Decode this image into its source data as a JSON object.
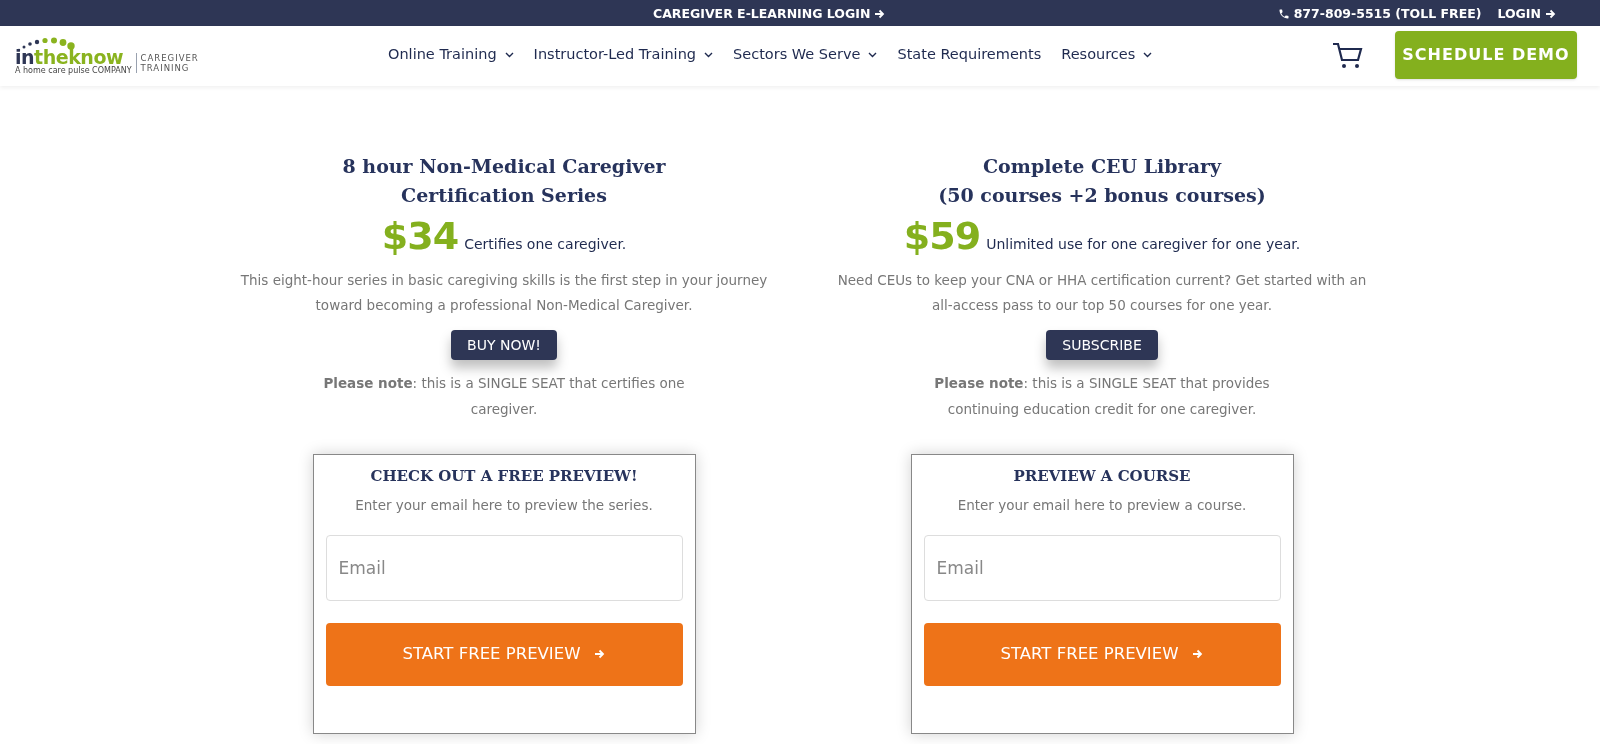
{
  "top_bar": {
    "elearning_link": "CAREGIVER E-LEARNING LOGIN",
    "phone": "877-809-5515 (TOLL FREE)",
    "login_link": "LOGIN"
  },
  "header": {
    "logo": {
      "parts": [
        "in",
        "theknow"
      ],
      "tagline": "A home care pulse COMPANY",
      "side_text": [
        "CAREGIVER",
        "TRAINING"
      ]
    },
    "nav": [
      {
        "label": "Online Training",
        "dropdown": true
      },
      {
        "label": "Instructor-Led Training",
        "dropdown": true
      },
      {
        "label": "Sectors We Serve",
        "dropdown": true
      },
      {
        "label": "State Requirements",
        "dropdown": false
      },
      {
        "label": "Resources",
        "dropdown": true
      }
    ],
    "cta": "SCHEDULE DEMO"
  },
  "offers": [
    {
      "title": [
        "8 hour Non-Medical Caregiver",
        "Certification Series"
      ],
      "price": "$34",
      "price_note": "Certifies one caregiver.",
      "description": "This eight-hour series in basic caregiving skills is the first step in your journey toward becoming a professional Non-Medical Caregiver.",
      "button": "BUY NOW!",
      "note": "**Please note**: this is a SINGLE SEAT that certifies one caregiver.",
      "preview": {
        "title": "CHECK OUT A FREE PREVIEW!",
        "text": "Enter your email here to preview the series.",
        "placeholder": "Email",
        "button": "START FREE PREVIEW"
      }
    },
    {
      "title": [
        "Complete CEU Library",
        "(50 courses +2 bonus courses)"
      ],
      "price": "$59",
      "price_note": "Unlimited use for one caregiver for one year.",
      "description": "Need CEUs to keep your CNA or HHA certification current? Get started with an all-access pass to our top 50 courses for one year.",
      "button": "SUBSCRIBE",
      "note": "**Please note**: this is a SINGLE SEAT that provides continuing education credit for one caregiver.",
      "preview": {
        "title": "PREVIEW A COURSE",
        "text": "Enter your email here to preview a course.",
        "placeholder": "Email",
        "button": "START FREE PREVIEW"
      }
    }
  ]
}
